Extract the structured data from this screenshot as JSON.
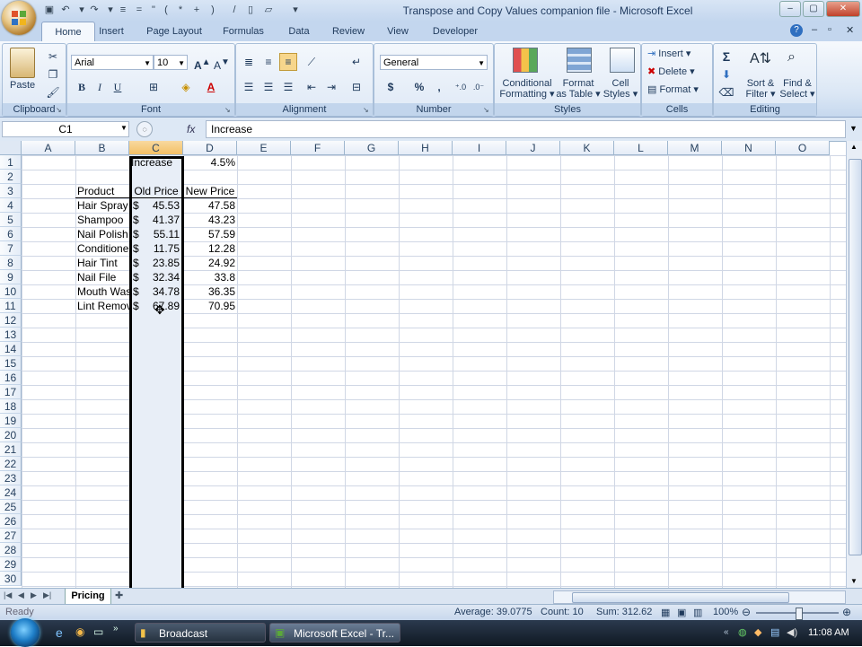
{
  "window": {
    "title": "Transpose and Copy Values companion file - Microsoft Excel"
  },
  "tabs": [
    {
      "label": "Home",
      "active": true
    },
    {
      "label": "Insert"
    },
    {
      "label": "Page Layout"
    },
    {
      "label": "Formulas"
    },
    {
      "label": "Data"
    },
    {
      "label": "Review"
    },
    {
      "label": "View"
    },
    {
      "label": "Developer"
    }
  ],
  "ribbon": {
    "clipboard": {
      "label": "Clipboard",
      "paste": "Paste"
    },
    "font": {
      "label": "Font",
      "name": "Arial",
      "size": "10",
      "bold": "B",
      "italic": "I",
      "underline": "U"
    },
    "alignment": {
      "label": "Alignment"
    },
    "number": {
      "label": "Number",
      "format": "General",
      "currency": "$",
      "percent": "%",
      "comma": ","
    },
    "styles": {
      "label": "Styles",
      "conditional": "Conditional",
      "conditional2": "Formatting",
      "format_table": "Format",
      "format_table2": "as Table",
      "cell_styles": "Cell",
      "cell_styles2": "Styles"
    },
    "cells": {
      "label": "Cells",
      "insert": "Insert",
      "delete": "Delete",
      "format": "Format"
    },
    "editing": {
      "label": "Editing",
      "sum": "Σ",
      "sort": "Sort &",
      "sort2": "Filter",
      "find": "Find &",
      "find2": "Select"
    }
  },
  "formula_bar": {
    "name_box": "C1",
    "fx": "fx",
    "value": "Increase"
  },
  "columns": [
    "A",
    "B",
    "C",
    "D",
    "E",
    "F",
    "G",
    "H",
    "I",
    "J",
    "K",
    "L",
    "M",
    "N",
    "O"
  ],
  "selected_column": "C",
  "rows": [
    "1",
    "2",
    "3",
    "4",
    "5",
    "6",
    "7",
    "8",
    "9",
    "10",
    "11",
    "12",
    "13",
    "14",
    "15",
    "16",
    "17",
    "18",
    "19",
    "20",
    "21",
    "22",
    "23",
    "24",
    "25",
    "26",
    "27",
    "28",
    "29",
    "30"
  ],
  "sheet": {
    "c1": "Increase",
    "d1": "4.5%",
    "headers": {
      "product": "Product",
      "old": "Old Price",
      "new": "New Price"
    },
    "items": [
      {
        "product": "Hair Spray",
        "cur": "$",
        "old": "45.53",
        "new": "47.58"
      },
      {
        "product": "Shampoo",
        "cur": "$",
        "old": "41.37",
        "new": "43.23"
      },
      {
        "product": "Nail Polish",
        "cur": "$",
        "old": "55.11",
        "new": "57.59"
      },
      {
        "product": "Conditioner",
        "cur": "$",
        "old": "11.75",
        "new": "12.28"
      },
      {
        "product": "Hair Tint",
        "cur": "$",
        "old": "23.85",
        "new": "24.92"
      },
      {
        "product": "Nail File",
        "cur": "$",
        "old": "32.34",
        "new": "33.8"
      },
      {
        "product": "Mouth Wash",
        "cur": "$",
        "old": "34.78",
        "new": "36.35"
      },
      {
        "product": "Lint Remover",
        "cur": "$",
        "old": "67.89",
        "new": "70.95"
      }
    ]
  },
  "sheet_tab": "Pricing",
  "status": {
    "ready": "Ready",
    "average": "Average: 39.0775",
    "count": "Count: 10",
    "sum": "Sum: 312.62",
    "zoom": "100%"
  },
  "taskbar": {
    "broadcast": "Broadcast",
    "excel": "Microsoft Excel - Tr...",
    "clock": "11:08 AM"
  }
}
